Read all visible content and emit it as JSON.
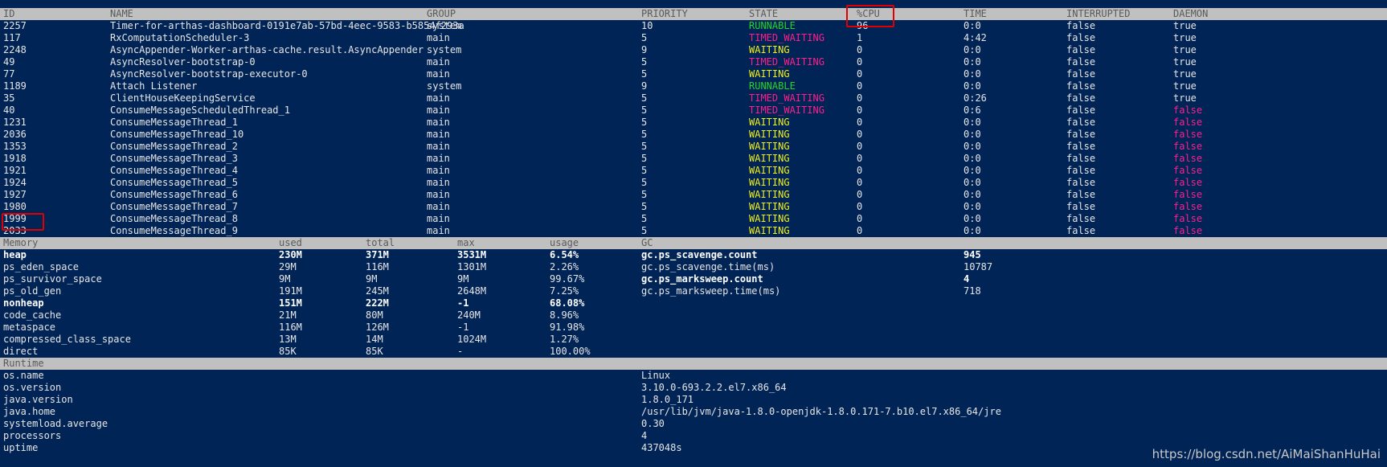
{
  "threads": {
    "headers": {
      "id": "ID",
      "name": "NAME",
      "group": "GROUP",
      "priority": "PRIORITY",
      "state": "STATE",
      "cpu": "%CPU",
      "time": "TIME",
      "interrupted": "INTERRUPTED",
      "daemon": "DAEMON"
    },
    "rows": [
      {
        "id": "2257",
        "name": "Timer-for-arthas-dashboard-0191e7ab-57bd-4eec-9583-b5854f293a",
        "group": "system",
        "priority": "10",
        "state": "RUNNABLE",
        "cpu": "96",
        "time": "0:0",
        "interrupted": "false",
        "daemon": "true"
      },
      {
        "id": "117",
        "name": "RxComputationScheduler-3",
        "group": "main",
        "priority": "5",
        "state": "TIMED_WAITING",
        "cpu": "1",
        "time": "4:42",
        "interrupted": "false",
        "daemon": "true"
      },
      {
        "id": "2248",
        "name": "AsyncAppender-Worker-arthas-cache.result.AsyncAppender",
        "group": "system",
        "priority": "9",
        "state": "WAITING",
        "cpu": "0",
        "time": "0:0",
        "interrupted": "false",
        "daemon": "true"
      },
      {
        "id": "49",
        "name": "AsyncResolver-bootstrap-0",
        "group": "main",
        "priority": "5",
        "state": "TIMED_WAITING",
        "cpu": "0",
        "time": "0:0",
        "interrupted": "false",
        "daemon": "true"
      },
      {
        "id": "77",
        "name": "AsyncResolver-bootstrap-executor-0",
        "group": "main",
        "priority": "5",
        "state": "WAITING",
        "cpu": "0",
        "time": "0:0",
        "interrupted": "false",
        "daemon": "true"
      },
      {
        "id": "1189",
        "name": "Attach Listener",
        "group": "system",
        "priority": "9",
        "state": "RUNNABLE",
        "cpu": "0",
        "time": "0:0",
        "interrupted": "false",
        "daemon": "true"
      },
      {
        "id": "35",
        "name": "ClientHouseKeepingService",
        "group": "main",
        "priority": "5",
        "state": "TIMED_WAITING",
        "cpu": "0",
        "time": "0:26",
        "interrupted": "false",
        "daemon": "true"
      },
      {
        "id": "40",
        "name": "ConsumeMessageScheduledThread_1",
        "group": "main",
        "priority": "5",
        "state": "TIMED_WAITING",
        "cpu": "0",
        "time": "0:6",
        "interrupted": "false",
        "daemon": "false"
      },
      {
        "id": "1231",
        "name": "ConsumeMessageThread_1",
        "group": "main",
        "priority": "5",
        "state": "WAITING",
        "cpu": "0",
        "time": "0:0",
        "interrupted": "false",
        "daemon": "false"
      },
      {
        "id": "2036",
        "name": "ConsumeMessageThread_10",
        "group": "main",
        "priority": "5",
        "state": "WAITING",
        "cpu": "0",
        "time": "0:0",
        "interrupted": "false",
        "daemon": "false"
      },
      {
        "id": "1353",
        "name": "ConsumeMessageThread_2",
        "group": "main",
        "priority": "5",
        "state": "WAITING",
        "cpu": "0",
        "time": "0:0",
        "interrupted": "false",
        "daemon": "false"
      },
      {
        "id": "1918",
        "name": "ConsumeMessageThread_3",
        "group": "main",
        "priority": "5",
        "state": "WAITING",
        "cpu": "0",
        "time": "0:0",
        "interrupted": "false",
        "daemon": "false"
      },
      {
        "id": "1921",
        "name": "ConsumeMessageThread_4",
        "group": "main",
        "priority": "5",
        "state": "WAITING",
        "cpu": "0",
        "time": "0:0",
        "interrupted": "false",
        "daemon": "false"
      },
      {
        "id": "1924",
        "name": "ConsumeMessageThread_5",
        "group": "main",
        "priority": "5",
        "state": "WAITING",
        "cpu": "0",
        "time": "0:0",
        "interrupted": "false",
        "daemon": "false"
      },
      {
        "id": "1927",
        "name": "ConsumeMessageThread_6",
        "group": "main",
        "priority": "5",
        "state": "WAITING",
        "cpu": "0",
        "time": "0:0",
        "interrupted": "false",
        "daemon": "false"
      },
      {
        "id": "1980",
        "name": "ConsumeMessageThread_7",
        "group": "main",
        "priority": "5",
        "state": "WAITING",
        "cpu": "0",
        "time": "0:0",
        "interrupted": "false",
        "daemon": "false"
      },
      {
        "id": "1999",
        "name": "ConsumeMessageThread_8",
        "group": "main",
        "priority": "5",
        "state": "WAITING",
        "cpu": "0",
        "time": "0:0",
        "interrupted": "false",
        "daemon": "false"
      },
      {
        "id": "2033",
        "name": "ConsumeMessageThread_9",
        "group": "main",
        "priority": "5",
        "state": "WAITING",
        "cpu": "0",
        "time": "0:0",
        "interrupted": "false",
        "daemon": "false"
      }
    ]
  },
  "memory": {
    "headers": {
      "memory": "Memory",
      "used": "used",
      "total": "total",
      "max": "max",
      "usage": "usage",
      "gc": "GC"
    },
    "rows": [
      {
        "name": "heap",
        "used": "230M",
        "total": "371M",
        "max": "3531M",
        "usage": "6.54%",
        "bold": true
      },
      {
        "name": "ps_eden_space",
        "used": "29M",
        "total": "116M",
        "max": "1301M",
        "usage": "2.26%",
        "bold": false
      },
      {
        "name": "ps_survivor_space",
        "used": "9M",
        "total": "9M",
        "max": "9M",
        "usage": "99.67%",
        "bold": false
      },
      {
        "name": "ps_old_gen",
        "used": "191M",
        "total": "245M",
        "max": "2648M",
        "usage": "7.25%",
        "bold": false
      },
      {
        "name": "nonheap",
        "used": "151M",
        "total": "222M",
        "max": "-1",
        "usage": "68.08%",
        "bold": true
      },
      {
        "name": "code_cache",
        "used": "21M",
        "total": "80M",
        "max": "240M",
        "usage": "8.96%",
        "bold": false
      },
      {
        "name": "metaspace",
        "used": "116M",
        "total": "126M",
        "max": "-1",
        "usage": "91.98%",
        "bold": false
      },
      {
        "name": "compressed_class_space",
        "used": "13M",
        "total": "14M",
        "max": "1024M",
        "usage": "1.27%",
        "bold": false
      },
      {
        "name": "direct",
        "used": "85K",
        "total": "85K",
        "max": "-",
        "usage": "100.00%",
        "bold": false
      }
    ],
    "gc": [
      {
        "name": "gc.ps_scavenge.count",
        "value": "945",
        "bold": true
      },
      {
        "name": "gc.ps_scavenge.time(ms)",
        "value": "10787",
        "bold": false
      },
      {
        "name": "gc.ps_marksweep.count",
        "value": "4",
        "bold": true
      },
      {
        "name": "gc.ps_marksweep.time(ms)",
        "value": "718",
        "bold": false
      }
    ]
  },
  "runtime": {
    "header": "Runtime",
    "rows": [
      {
        "name": "os.name",
        "value": "Linux"
      },
      {
        "name": "os.version",
        "value": "3.10.0-693.2.2.el7.x86_64"
      },
      {
        "name": "java.version",
        "value": "1.8.0_171"
      },
      {
        "name": "java.home",
        "value": "/usr/lib/jvm/java-1.8.0-openjdk-1.8.0.171-7.b10.el7.x86_64/jre"
      },
      {
        "name": "systemload.average",
        "value": "0.30"
      },
      {
        "name": "processors",
        "value": "4"
      },
      {
        "name": "uptime",
        "value": "437048s"
      }
    ]
  },
  "watermark": "https://blog.csdn.net/AiMaiShanHuHai",
  "colors": {
    "background": "#012456",
    "header": "#c0c0c0",
    "runnable": "#27d32a",
    "timed_waiting": "#ff1f8a",
    "waiting": "#f2f01a",
    "highlight_box": "#e00000"
  }
}
